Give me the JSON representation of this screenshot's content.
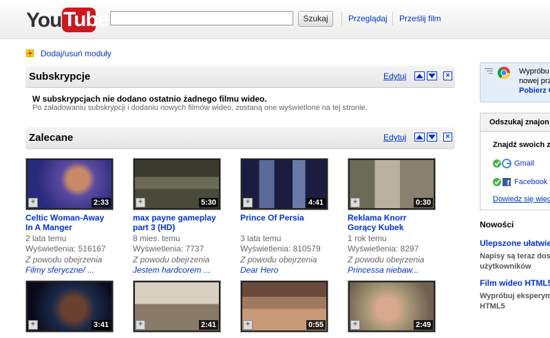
{
  "header": {
    "logo_you": "You",
    "logo_tube": "Tube",
    "search_button": "Szukaj",
    "nav": [
      "Przeglądaj",
      "Prześlij film"
    ]
  },
  "add_modules": "Dodaj/usuń moduły",
  "subscriptions": {
    "title": "Subskrypcje",
    "edit": "Edytuj",
    "empty_bold": "W subskrypcjach nie dodano ostatnio żadnego filmu wideo.",
    "empty_text": "Po załadowaniu subskrypcji i dodaniu nowych filmów wideo, zostaną one wyświetlone na tej stronie."
  },
  "recommended": {
    "title": "Zalecane",
    "edit": "Edytuj",
    "videos": [
      {
        "title": "Celtic Woman-Away In A Manger",
        "duration": "2:33",
        "age": "2 lata temu",
        "views": "Wyświetlenia: 516167",
        "reason": "Z powodu obejrzenia",
        "because": "Filmy sferyczne/ ..."
      },
      {
        "title": "max payne gameplay part 3 (HD)",
        "duration": "5:30",
        "age": "8 mies. temu",
        "views": "Wyświetlenia: 7737",
        "reason": "Z powodu obejrzenia",
        "because": "Jestem hardcorem ..."
      },
      {
        "title": "Prince Of Persia",
        "duration": "4:41",
        "age": "3 lata temu",
        "views": "Wyświetlenia: 810579",
        "reason": "Z powodu obejrzenia",
        "because": "Dear Hero"
      },
      {
        "title": "Reklama Knorr Gorący Kubek",
        "duration": "0:30",
        "age": "1 rok temu",
        "views": "Wyświetlenia: 8297",
        "reason": "Z powodu obejrzenia",
        "because": "Princessa niebaw..."
      },
      {
        "title": "",
        "duration": "3:41"
      },
      {
        "title": "",
        "duration": "2:41"
      },
      {
        "title": "",
        "duration": "0:55"
      },
      {
        "title": "",
        "duration": "2:49"
      }
    ]
  },
  "sidebar": {
    "promo_line1": "Wypróbu",
    "promo_line2": "nowej prz",
    "promo_link": "Pobierz C",
    "find_head": "Odszukaj znajon",
    "find_sub": "Znajdź swoich z",
    "gmail": "Gmail",
    "facebook": "Facebook",
    "learn_more": "Dowiedz się więc",
    "news_head": "Nowości",
    "news1_title": "Ulepszone ułatwie",
    "news1_line1": "Napisy są teraz dos",
    "news1_line2": "użytkowników",
    "news2_title": "Film wideo HTML5",
    "news2_line1": "Wypróbuj eksperym",
    "news2_line2": "HTML5"
  }
}
